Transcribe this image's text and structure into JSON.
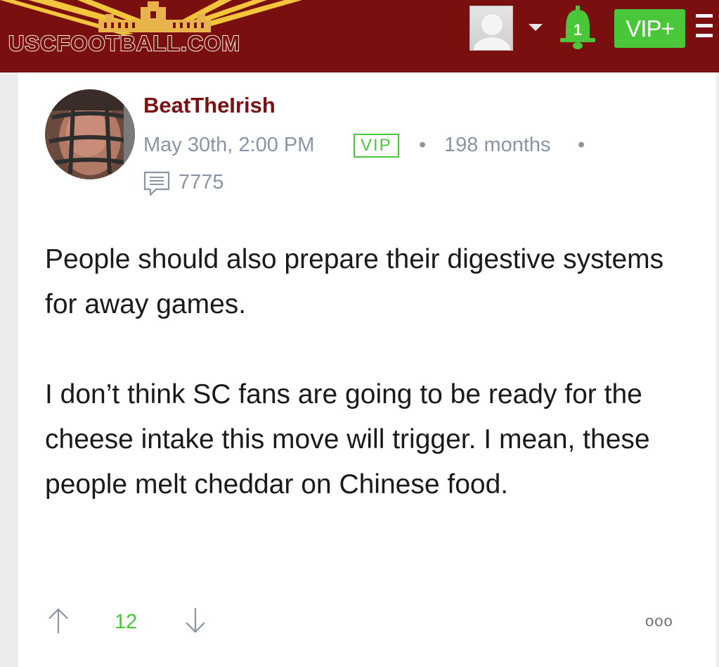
{
  "header": {
    "logo_text": "USCFOOTBALL.COM",
    "notification_count": "1",
    "vip_button_label": "VIP+"
  },
  "post": {
    "username": "BeatTheIrish",
    "date": "May 30th, 2:00 PM",
    "badge": "VIP",
    "separator": "•",
    "membership": "198 months",
    "comment_count": "7775",
    "paragraphs": [
      "People should also prepare their digestive systems for away games.",
      "I don’t think SC fans are going to be ready for the cheese intake this move will trigger. I mean, these people melt cheddar on Chinese food."
    ],
    "votes": "12",
    "more_label": "ooo"
  },
  "colors": {
    "header_bg": "#7a0f10",
    "username": "#7a1011",
    "accent_green": "#49c63a",
    "meta_gray": "#8a95a3"
  },
  "icons": [
    "user-avatar-icon",
    "caret-down-icon",
    "bell-icon",
    "hamburger-menu-icon",
    "comment-icon",
    "arrow-up-icon",
    "arrow-down-icon",
    "more-options-icon"
  ]
}
